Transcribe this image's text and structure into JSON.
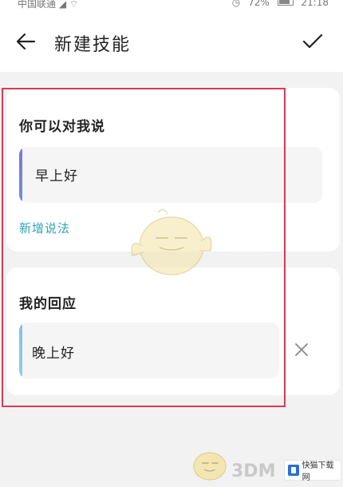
{
  "status_bar": {
    "carrier": "中国联通",
    "battery": "72%",
    "time": "21:18"
  },
  "header": {
    "back_icon": "arrow-left-icon",
    "title": "新建技能",
    "confirm_icon": "check-icon"
  },
  "trigger_section": {
    "title": "你可以对我说",
    "phrases": [
      "早上好"
    ],
    "add_label": "新增说法",
    "accent_color": "#7b74d6"
  },
  "reply_section": {
    "title": "我的回应",
    "replies": [
      "晚上好"
    ],
    "delete_icon": "close-icon",
    "accent_color": "#7cc3e8"
  },
  "watermark": {
    "text": "3DM",
    "badge": "快猫下载网"
  },
  "colors": {
    "link": "#2fa6b3",
    "highlight": "#d83a52",
    "background": "#f2f2f2"
  }
}
